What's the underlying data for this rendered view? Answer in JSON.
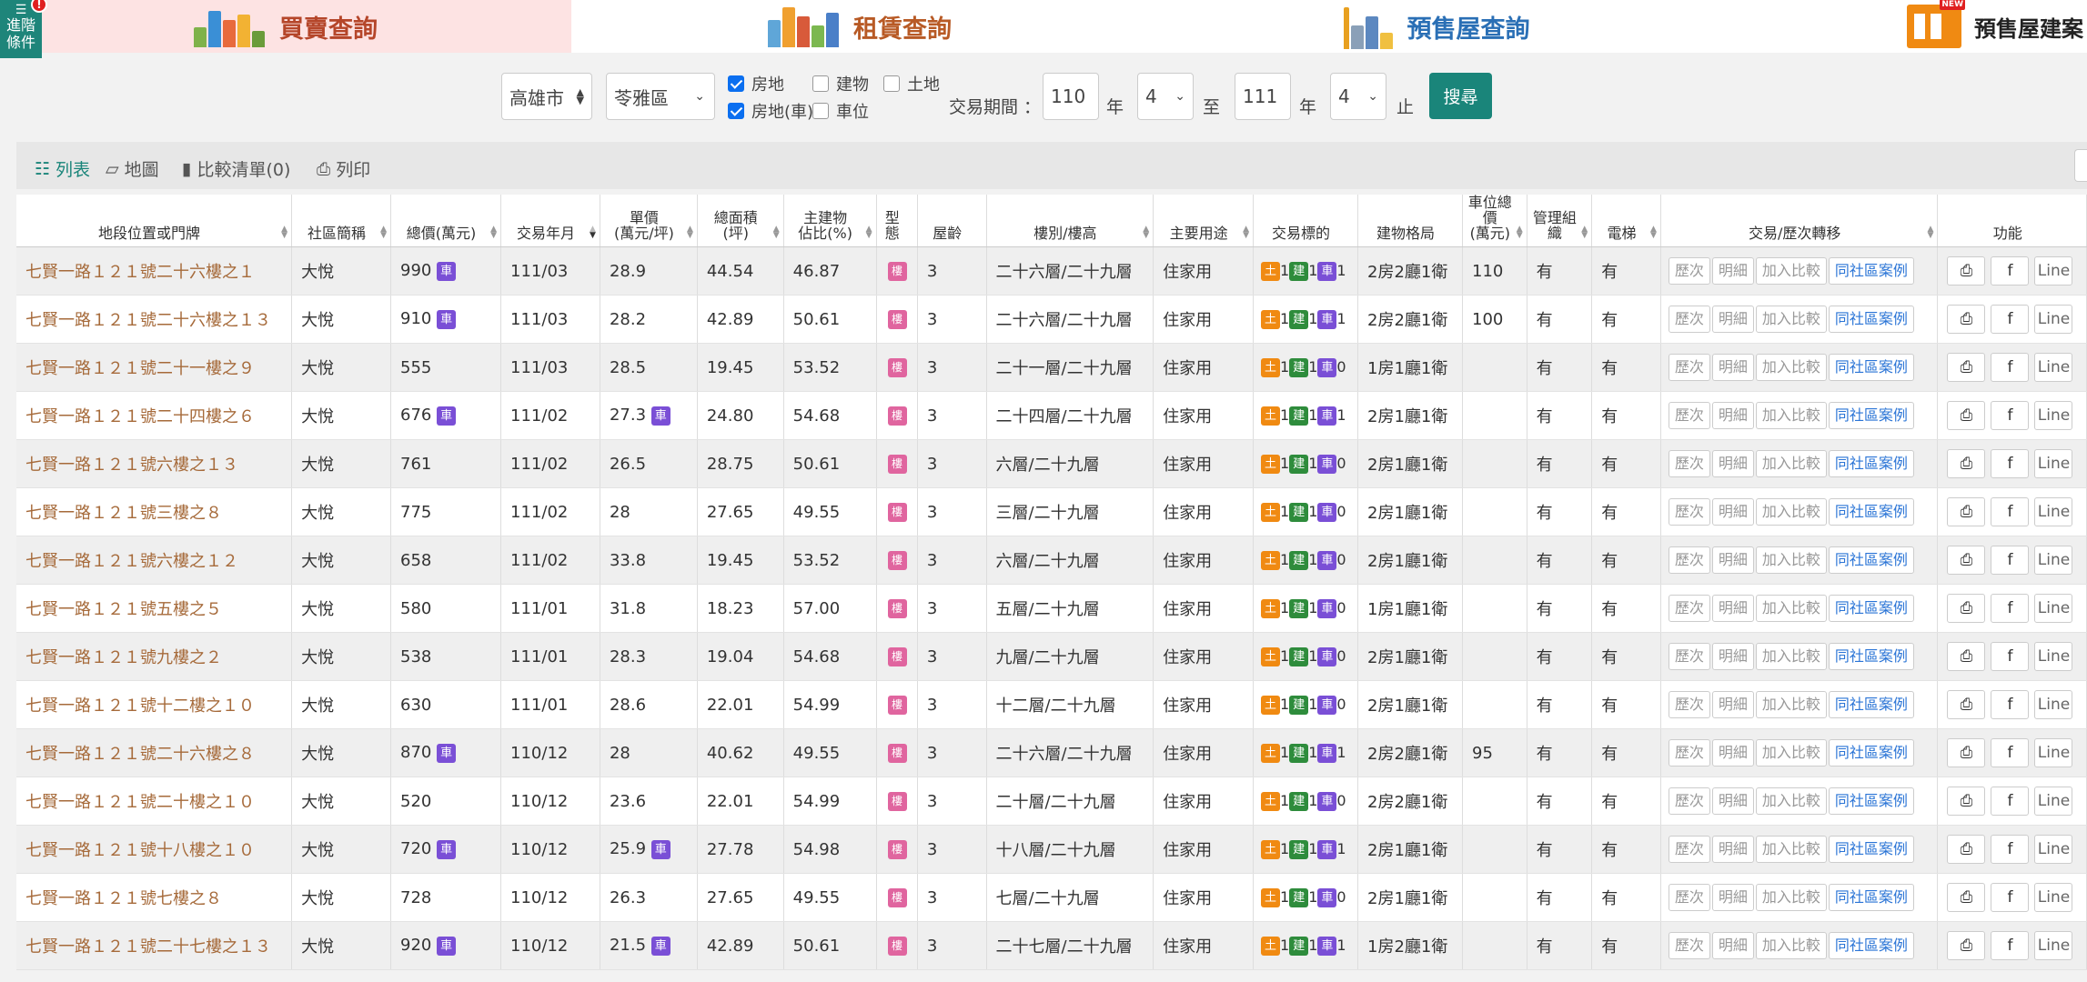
{
  "nav": {
    "adv_line1": "進階",
    "adv_line2": "條件",
    "adv_alert": "!",
    "tabs": [
      {
        "label": "買賣查詢",
        "color": "#b5462a"
      },
      {
        "label": "租賃查詢",
        "color": "#b85a25"
      },
      {
        "label": "預售屋查詢",
        "color": "#2a6fb5"
      },
      {
        "label": "預售屋建案"
      }
    ],
    "tab_new_badge": "NEW"
  },
  "filter": {
    "city": "高雄市",
    "district": "苓雅區",
    "types": [
      {
        "label": "房地",
        "checked": true
      },
      {
        "label": "建物",
        "checked": false
      },
      {
        "label": "土地",
        "checked": false
      },
      {
        "label": "房地(車)",
        "checked": true
      },
      {
        "label": "車位",
        "checked": false
      }
    ],
    "period_label": "交易期間 ：",
    "from_year": "110",
    "year_unit": "年",
    "from_month": "4",
    "to_label": "至",
    "to_year": "111",
    "to_month": "4",
    "end_label": "止",
    "search_label": "搜尋"
  },
  "toolbar": {
    "list": "列表",
    "map": "地圖",
    "compare": "比較清單(0)",
    "print": "列印"
  },
  "table": {
    "headers": [
      "地段位置或門牌",
      "社區簡稱",
      "總價(萬元)",
      "交易年月",
      "單價\n(萬元/坪)",
      "總面積\n(坪)",
      "主建物\n佔比(%)",
      "型態",
      "屋齡",
      "樓別/樓高",
      "主要用途",
      "交易標的",
      "建物格局",
      "車位總價\n(萬元)",
      "管理組織",
      "電梯",
      "交易/歷次轉移",
      "功能"
    ],
    "badges": {
      "parking": "車",
      "building": "樓",
      "land": "土",
      "structure": "建",
      "car": "車"
    },
    "actions": [
      "歷次",
      "明細",
      "加入比較",
      "同社區案例"
    ],
    "func_line": "Line",
    "rows": [
      {
        "addr": "七賢一路１２１號二十六樓之１",
        "comm": "大悅",
        "total": "990",
        "tp": true,
        "ym": "111/03",
        "unit": "28.9",
        "up": false,
        "area": "44.54",
        "ratio": "46.87",
        "age": "3",
        "floor": "二十六層/二十九層",
        "use": "住家用",
        "land": "1",
        "bldg": "1",
        "car": "1",
        "layout": "2房2廳1衛",
        "cp": "110",
        "mgmt": "有",
        "elev": "有"
      },
      {
        "addr": "七賢一路１２１號二十六樓之１３",
        "comm": "大悅",
        "total": "910",
        "tp": true,
        "ym": "111/03",
        "unit": "28.2",
        "up": false,
        "area": "42.89",
        "ratio": "50.61",
        "age": "3",
        "floor": "二十六層/二十九層",
        "use": "住家用",
        "land": "1",
        "bldg": "1",
        "car": "1",
        "layout": "2房2廳1衛",
        "cp": "100",
        "mgmt": "有",
        "elev": "有"
      },
      {
        "addr": "七賢一路１２１號二十一樓之９",
        "comm": "大悅",
        "total": "555",
        "tp": false,
        "ym": "111/03",
        "unit": "28.5",
        "up": false,
        "area": "19.45",
        "ratio": "53.52",
        "age": "3",
        "floor": "二十一層/二十九層",
        "use": "住家用",
        "land": "1",
        "bldg": "1",
        "car": "0",
        "layout": "1房1廳1衛",
        "cp": "",
        "mgmt": "有",
        "elev": "有"
      },
      {
        "addr": "七賢一路１２１號二十四樓之６",
        "comm": "大悅",
        "total": "676",
        "tp": true,
        "ym": "111/02",
        "unit": "27.3",
        "up": true,
        "area": "24.80",
        "ratio": "54.68",
        "age": "3",
        "floor": "二十四層/二十九層",
        "use": "住家用",
        "land": "1",
        "bldg": "1",
        "car": "1",
        "layout": "2房1廳1衛",
        "cp": "",
        "mgmt": "有",
        "elev": "有"
      },
      {
        "addr": "七賢一路１２１號六樓之１３",
        "comm": "大悅",
        "total": "761",
        "tp": false,
        "ym": "111/02",
        "unit": "26.5",
        "up": false,
        "area": "28.75",
        "ratio": "50.61",
        "age": "3",
        "floor": "六層/二十九層",
        "use": "住家用",
        "land": "1",
        "bldg": "1",
        "car": "0",
        "layout": "2房1廳1衛",
        "cp": "",
        "mgmt": "有",
        "elev": "有"
      },
      {
        "addr": "七賢一路１２１號三樓之８",
        "comm": "大悅",
        "total": "775",
        "tp": false,
        "ym": "111/02",
        "unit": "28",
        "up": false,
        "area": "27.65",
        "ratio": "49.55",
        "age": "3",
        "floor": "三層/二十九層",
        "use": "住家用",
        "land": "1",
        "bldg": "1",
        "car": "0",
        "layout": "2房1廳1衛",
        "cp": "",
        "mgmt": "有",
        "elev": "有"
      },
      {
        "addr": "七賢一路１２１號六樓之１２",
        "comm": "大悅",
        "total": "658",
        "tp": false,
        "ym": "111/02",
        "unit": "33.8",
        "up": false,
        "area": "19.45",
        "ratio": "53.52",
        "age": "3",
        "floor": "六層/二十九層",
        "use": "住家用",
        "land": "1",
        "bldg": "1",
        "car": "0",
        "layout": "2房1廳1衛",
        "cp": "",
        "mgmt": "有",
        "elev": "有"
      },
      {
        "addr": "七賢一路１２１號五樓之５",
        "comm": "大悅",
        "total": "580",
        "tp": false,
        "ym": "111/01",
        "unit": "31.8",
        "up": false,
        "area": "18.23",
        "ratio": "57.00",
        "age": "3",
        "floor": "五層/二十九層",
        "use": "住家用",
        "land": "1",
        "bldg": "1",
        "car": "0",
        "layout": "1房1廳1衛",
        "cp": "",
        "mgmt": "有",
        "elev": "有"
      },
      {
        "addr": "七賢一路１２１號九樓之２",
        "comm": "大悅",
        "total": "538",
        "tp": false,
        "ym": "111/01",
        "unit": "28.3",
        "up": false,
        "area": "19.04",
        "ratio": "54.68",
        "age": "3",
        "floor": "九層/二十九層",
        "use": "住家用",
        "land": "1",
        "bldg": "1",
        "car": "0",
        "layout": "2房1廳1衛",
        "cp": "",
        "mgmt": "有",
        "elev": "有"
      },
      {
        "addr": "七賢一路１２１號十二樓之１０",
        "comm": "大悅",
        "total": "630",
        "tp": false,
        "ym": "111/01",
        "unit": "28.6",
        "up": false,
        "area": "22.01",
        "ratio": "54.99",
        "age": "3",
        "floor": "十二層/二十九層",
        "use": "住家用",
        "land": "1",
        "bldg": "1",
        "car": "0",
        "layout": "2房1廳1衛",
        "cp": "",
        "mgmt": "有",
        "elev": "有"
      },
      {
        "addr": "七賢一路１２１號二十六樓之８",
        "comm": "大悅",
        "total": "870",
        "tp": true,
        "ym": "110/12",
        "unit": "28",
        "up": false,
        "area": "40.62",
        "ratio": "49.55",
        "age": "3",
        "floor": "二十六層/二十九層",
        "use": "住家用",
        "land": "1",
        "bldg": "1",
        "car": "1",
        "layout": "2房2廳1衛",
        "cp": "95",
        "mgmt": "有",
        "elev": "有"
      },
      {
        "addr": "七賢一路１２１號二十樓之１０",
        "comm": "大悅",
        "total": "520",
        "tp": false,
        "ym": "110/12",
        "unit": "23.6",
        "up": false,
        "area": "22.01",
        "ratio": "54.99",
        "age": "3",
        "floor": "二十層/二十九層",
        "use": "住家用",
        "land": "1",
        "bldg": "1",
        "car": "0",
        "layout": "2房2廳1衛",
        "cp": "",
        "mgmt": "有",
        "elev": "有"
      },
      {
        "addr": "七賢一路１２１號十八樓之１０",
        "comm": "大悅",
        "total": "720",
        "tp": true,
        "ym": "110/12",
        "unit": "25.9",
        "up": true,
        "area": "27.78",
        "ratio": "54.98",
        "age": "3",
        "floor": "十八層/二十九層",
        "use": "住家用",
        "land": "1",
        "bldg": "1",
        "car": "1",
        "layout": "2房1廳1衛",
        "cp": "",
        "mgmt": "有",
        "elev": "有"
      },
      {
        "addr": "七賢一路１２１號七樓之８",
        "comm": "大悅",
        "total": "728",
        "tp": false,
        "ym": "110/12",
        "unit": "26.3",
        "up": false,
        "area": "27.65",
        "ratio": "49.55",
        "age": "3",
        "floor": "七層/二十九層",
        "use": "住家用",
        "land": "1",
        "bldg": "1",
        "car": "0",
        "layout": "2房1廳1衛",
        "cp": "",
        "mgmt": "有",
        "elev": "有"
      },
      {
        "addr": "七賢一路１２１號二十七樓之１３",
        "comm": "大悅",
        "total": "920",
        "tp": true,
        "ym": "110/12",
        "unit": "21.5",
        "up": true,
        "area": "42.89",
        "ratio": "50.61",
        "age": "3",
        "floor": "二十七層/二十九層",
        "use": "住家用",
        "land": "1",
        "bldg": "1",
        "car": "1",
        "layout": "1房2廳1衛",
        "cp": "",
        "mgmt": "有",
        "elev": "有"
      }
    ]
  }
}
